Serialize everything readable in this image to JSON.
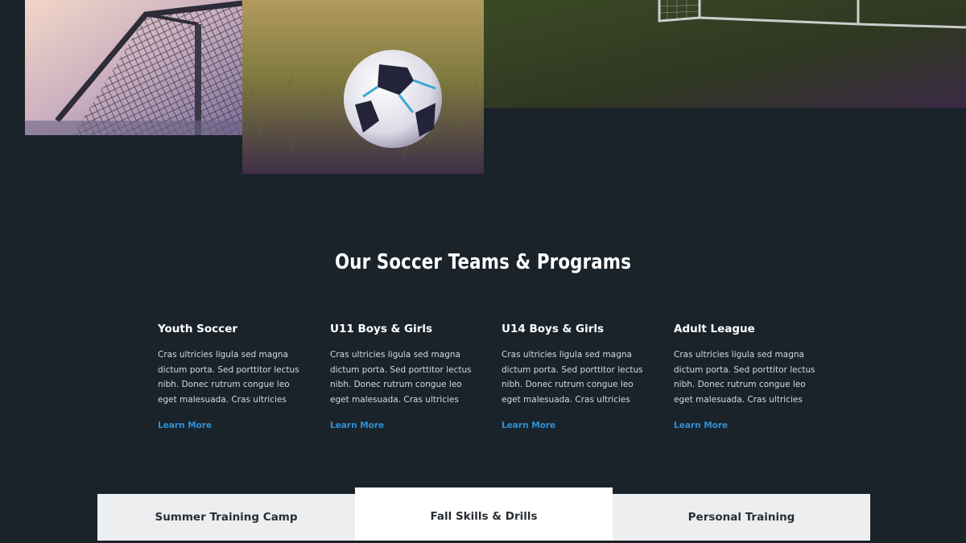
{
  "section": {
    "title": "Our Soccer Teams & Programs"
  },
  "programs": [
    {
      "title": "Youth Soccer",
      "description": "Cras ultricies ligula sed magna dictum porta. Sed porttitor lectus nibh. Donec rutrum congue leo eget malesuada. Cras ultricies",
      "link_label": "Learn More"
    },
    {
      "title": "U11 Boys & Girls",
      "description": "Cras ultricies ligula sed magna dictum porta. Sed porttitor lectus nibh. Donec rutrum congue leo eget malesuada. Cras ultricies",
      "link_label": "Learn More"
    },
    {
      "title": "U14 Boys & Girls",
      "description": "Cras ultricies ligula sed magna dictum porta. Sed porttitor lectus nibh. Donec rutrum congue leo eget malesuada. Cras ultricies",
      "link_label": "Learn More"
    },
    {
      "title": "Adult League",
      "description": "Cras ultricies ligula sed magna dictum porta. Sed porttitor lectus nibh. Donec rutrum congue leo eget malesuada. Cras ultricies",
      "link_label": "Learn More"
    }
  ],
  "tabs": [
    {
      "label": "Summer Training Camp",
      "active": false
    },
    {
      "label": "Fall Skills & Drills",
      "active": true
    },
    {
      "label": "Personal Training",
      "active": false
    }
  ],
  "colors": {
    "background": "#1a232a",
    "link": "#2e8fd6",
    "tab_inactive": "#eceef0",
    "tab_active": "#ffffff"
  }
}
